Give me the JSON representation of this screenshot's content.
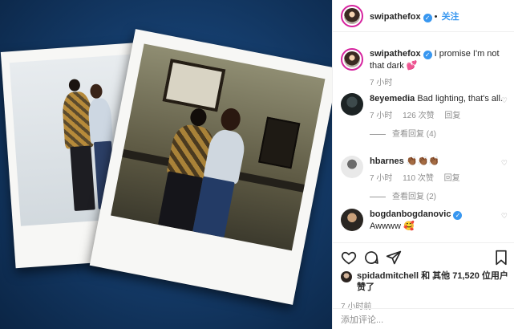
{
  "post": {
    "username": "swipathefox",
    "follow_label": "关注",
    "caption": "I promise I'm not that dark 💕",
    "caption_time": "7 小时"
  },
  "comments": [
    {
      "username": "8eyemedia",
      "text": "Bad lighting, that's all.",
      "time": "7 小时",
      "likes": "126 次赞",
      "reply": "回复",
      "view_replies": "查看回复 (4)"
    },
    {
      "username": "hbarnes",
      "text": "👏🏾👏🏾👏🏾",
      "time": "7 小时",
      "likes": "110 次赞",
      "reply": "回复",
      "view_replies": "查看回复 (2)"
    },
    {
      "username": "bogdanbogdanovic",
      "text": "Awwww 🥰"
    }
  ],
  "likes": {
    "liker": "spidadmitchell",
    "text": "和 其他 71,520 位用户赞了"
  },
  "post_time": "7 小时前",
  "comment_box": {
    "placeholder": "添加评论..."
  },
  "colors": {
    "link": "#3897f0",
    "verified": "#3897f0",
    "muted": "#8e8e8e",
    "photo_bg": "#153d6c"
  },
  "icons": [
    "heart-icon",
    "comment-icon",
    "share-icon",
    "bookmark-icon",
    "verified-badge-icon"
  ]
}
